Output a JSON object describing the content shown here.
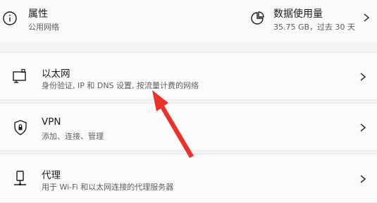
{
  "properties": {
    "title": "属性",
    "subtitle": "公用网络"
  },
  "data_usage": {
    "title": "数据使用量",
    "subtitle": "35.75 GB，过去 30 天"
  },
  "items": [
    {
      "title": "以太网",
      "subtitle": "身份验证, IP 和 DNS 设置, 按流量计费的网络",
      "icon": "ethernet-icon"
    },
    {
      "title": "VPN",
      "subtitle": "添加、连接、管理",
      "icon": "shield-icon"
    },
    {
      "title": "代理",
      "subtitle": "用于 Wi-Fi 和以太网连接的代理服务器",
      "icon": "proxy-icon"
    }
  ],
  "annotation": {
    "color": "#e8322c"
  }
}
